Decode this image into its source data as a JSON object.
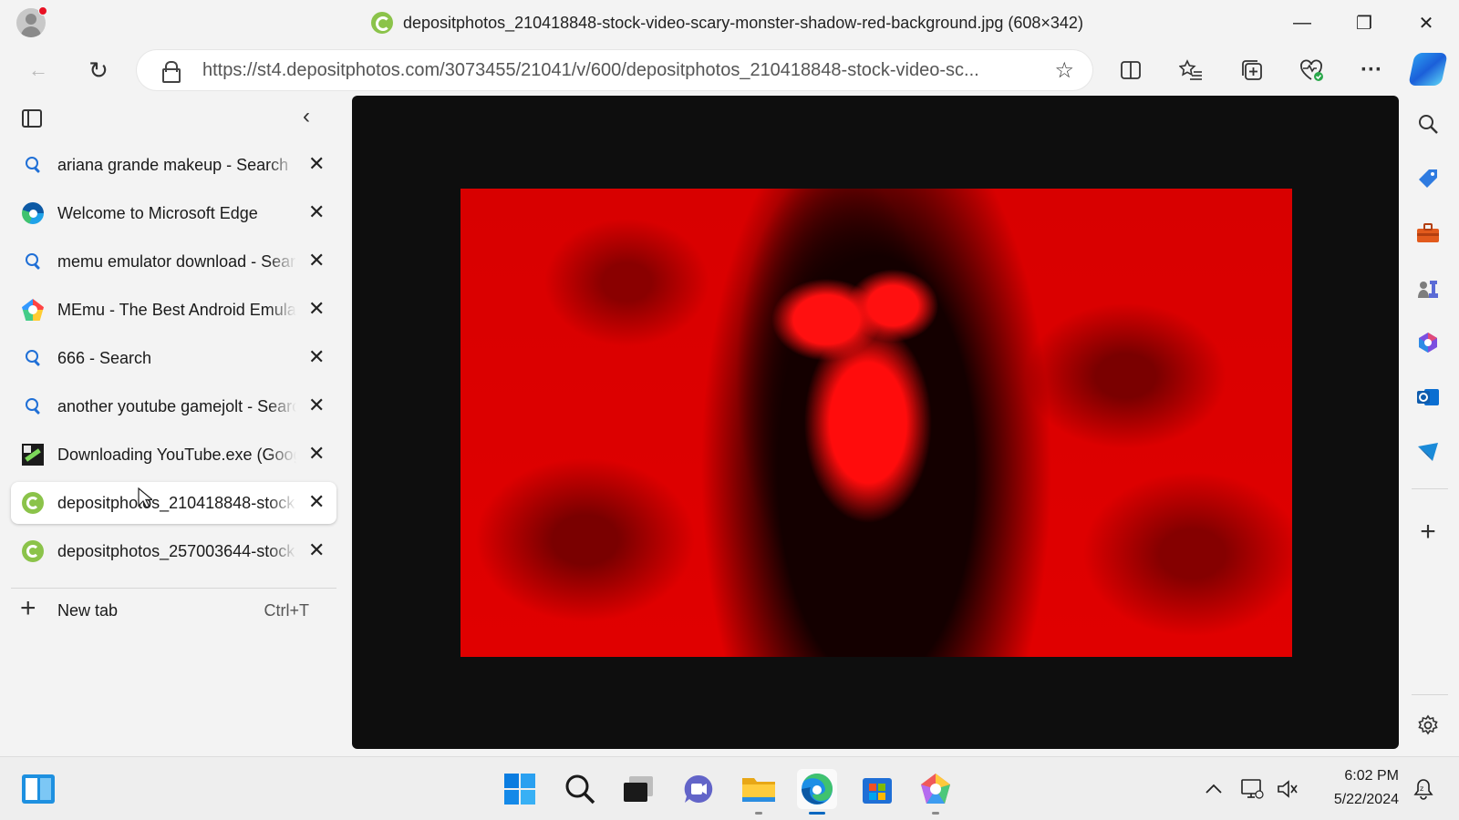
{
  "window": {
    "title": "depositphotos_210418848-stock-video-scary-monster-shadow-red-background.jpg (608×342)",
    "minimize": "—",
    "restore": "❐",
    "close": "✕"
  },
  "toolbar": {
    "back": "←",
    "refresh": "↻",
    "url": "https://st4.depositphotos.com/3073455/21041/v/600/depositphotos_210418848-stock-video-sc...",
    "favorite": "☆",
    "more": "···"
  },
  "tab_pane": {
    "collapse": "‹",
    "tabs": [
      {
        "label": "ariana grande makeup - Search",
        "favicon": "search-icon",
        "close": "✕"
      },
      {
        "label": "Welcome to Microsoft Edge",
        "favicon": "edge-icon",
        "close": "✕"
      },
      {
        "label": "memu emulator download - Search",
        "favicon": "search-icon",
        "close": "✕"
      },
      {
        "label": "MEmu - The Best Android Emulator",
        "favicon": "memu-icon",
        "close": "✕"
      },
      {
        "label": "666 - Search",
        "favicon": "search-icon",
        "close": "✕"
      },
      {
        "label": "another youtube gamejolt - Search",
        "favicon": "search-icon",
        "close": "✕"
      },
      {
        "label": "Downloading YouTube.exe (Google",
        "favicon": "download-site-icon",
        "close": "✕"
      },
      {
        "label": "depositphotos_210418848-stock",
        "favicon": "depositphotos-icon",
        "close": "✕",
        "active": true
      },
      {
        "label": "depositphotos_257003644-stock",
        "favicon": "depositphotos-icon",
        "close": "✕"
      }
    ],
    "new_tab": {
      "label": "New tab",
      "shortcut": "Ctrl+T"
    }
  },
  "sidebar": {
    "items": [
      "search-icon",
      "shopping-tag-icon",
      "tools-icon",
      "games-icon",
      "microsoft365-icon",
      "outlook-icon",
      "telegram-icon"
    ],
    "add": "+",
    "settings": "gear-icon"
  },
  "taskbar": {
    "time": "6:02 PM",
    "date": "5/22/2024",
    "apps": [
      "widgets-icon",
      "start-icon",
      "search-icon",
      "task-view-icon",
      "teams-chat-icon",
      "file-explorer-icon",
      "edge-icon",
      "store-icon",
      "memu-icon"
    ]
  },
  "colors": {
    "accent": "#0067c0",
    "image_red": "#e00000",
    "viewer_bg": "#0e0e0e"
  }
}
